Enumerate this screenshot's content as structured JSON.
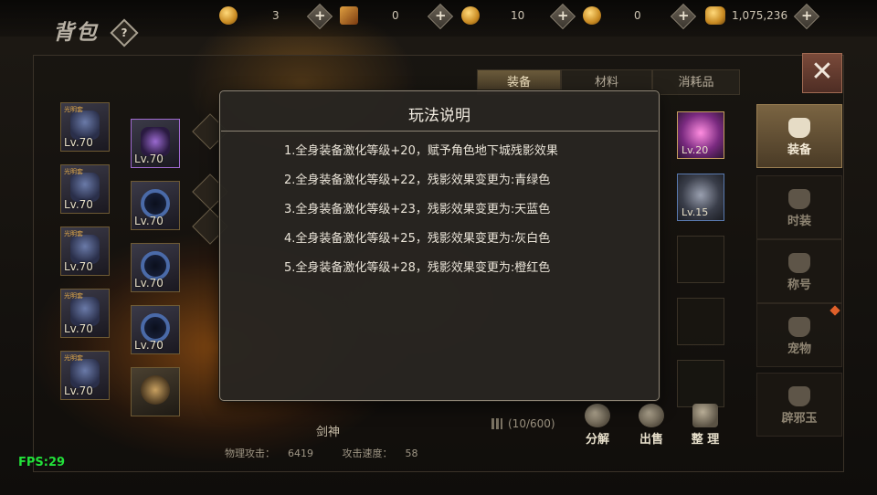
{
  "header": {
    "title": "背包",
    "help_symbol": "?",
    "close_symbol": "✕",
    "currencies": [
      {
        "icon": "gold-coin-icon",
        "amount": "3"
      },
      {
        "icon": "scroll-token-icon",
        "amount": "0"
      },
      {
        "icon": "medal-coin-icon",
        "amount": "10"
      },
      {
        "icon": "gold-coin-icon",
        "amount": "0"
      },
      {
        "icon": "gold-pile-icon",
        "amount": "1,075,236"
      }
    ],
    "plus_symbol": "+"
  },
  "equipment": {
    "left_column": [
      "Lv.70",
      "Lv.70",
      "Lv.70",
      "Lv.70",
      "Lv.70"
    ],
    "left_tag": "光明套",
    "right_column": [
      "Lv.70",
      "Lv.70",
      "Lv.70",
      "Lv.70",
      ""
    ]
  },
  "character": {
    "name": "剑神",
    "stats": [
      {
        "label": "物理攻击：",
        "value": "6419"
      },
      {
        "label": "攻击速度：",
        "value": "58"
      }
    ]
  },
  "inventory": {
    "tabs": [
      "装备",
      "材料",
      "消耗品"
    ],
    "active_tab": "装备",
    "items": [
      {
        "level": "Lv.20"
      },
      {
        "level": "Lv.15"
      }
    ],
    "count": "(10/600)",
    "actions": [
      "分解",
      "出售",
      "整 理"
    ]
  },
  "side_tabs": [
    "装备",
    "时装",
    "称号",
    "宠物",
    "辟邪玉"
  ],
  "modal": {
    "title": "玩法说明",
    "rules": [
      "1.全身装备激化等级+20，赋予角色地下城残影效果",
      "2.全身装备激化等级+22，残影效果变更为:青绿色",
      "3.全身装备激化等级+23，残影效果变更为:天蓝色",
      "4.全身装备激化等级+25，残影效果变更为:灰白色",
      "5.全身装备激化等级+28，残影效果变更为:橙红色"
    ]
  },
  "fps": "FPS:29",
  "colors": {
    "modal_bg": "#28251f",
    "accent_gold": "#c88a22",
    "fps_green": "#22e03a",
    "notify_dot": "#e0602a"
  }
}
